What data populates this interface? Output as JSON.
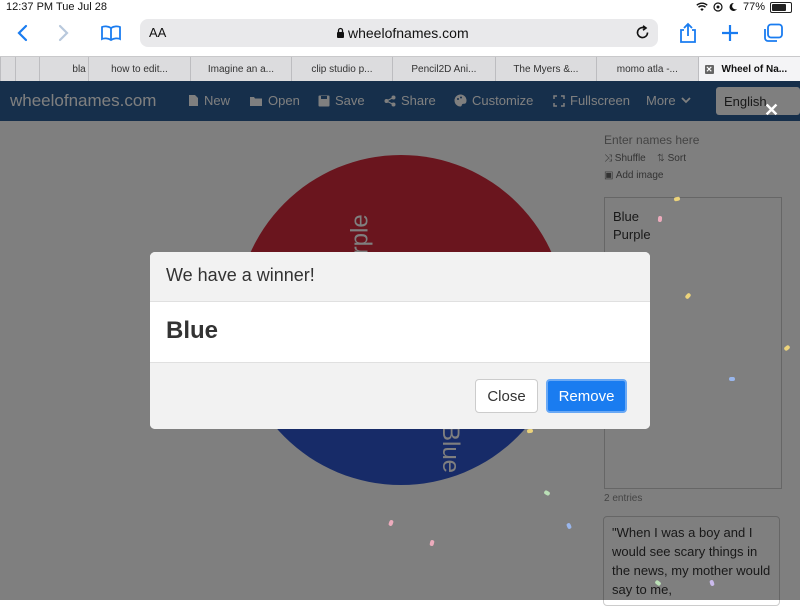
{
  "status": {
    "time": "12:37 PM",
    "date": "Tue Jul 28",
    "battery": "77%",
    "battery_level": 0.77
  },
  "browser": {
    "text_size_label": "AA",
    "url": "wheelofnames.com",
    "tabs": [
      {
        "label": "bla"
      },
      {
        "label": "how to edit..."
      },
      {
        "label": "Imagine an a..."
      },
      {
        "label": "clip studio p..."
      },
      {
        "label": "Pencil2D Ani..."
      },
      {
        "label": "The Myers &..."
      },
      {
        "label": "momo atla -..."
      },
      {
        "label": "Wheel of Na..."
      }
    ]
  },
  "site": {
    "brand": "wheelofnames.com",
    "nav": {
      "new": "New",
      "open": "Open",
      "save": "Save",
      "share": "Share",
      "customize": "Customize",
      "fullscreen": "Fullscreen",
      "more": "More"
    },
    "language": "English"
  },
  "wheel": {
    "entries": [
      "Purple",
      "Blue"
    ],
    "colors": {
      "top": "#d42a3c",
      "bottom": "#2f57d1"
    }
  },
  "sidebar": {
    "placeholder": "Enter names here",
    "shuffle": "Shuffle",
    "sort": "Sort",
    "add_image": "Add image",
    "names": [
      "Blue",
      "Purple"
    ],
    "entry_count": "2 entries",
    "quote": "\"When I was a boy and I would see scary things in the news, my mother would say to me,"
  },
  "modal": {
    "title": "We have a winner!",
    "winner": "Blue",
    "close_label": "Close",
    "remove_label": "Remove"
  },
  "colors": {
    "accent": "#1a7cf0",
    "navbar": "#2c5f97"
  }
}
